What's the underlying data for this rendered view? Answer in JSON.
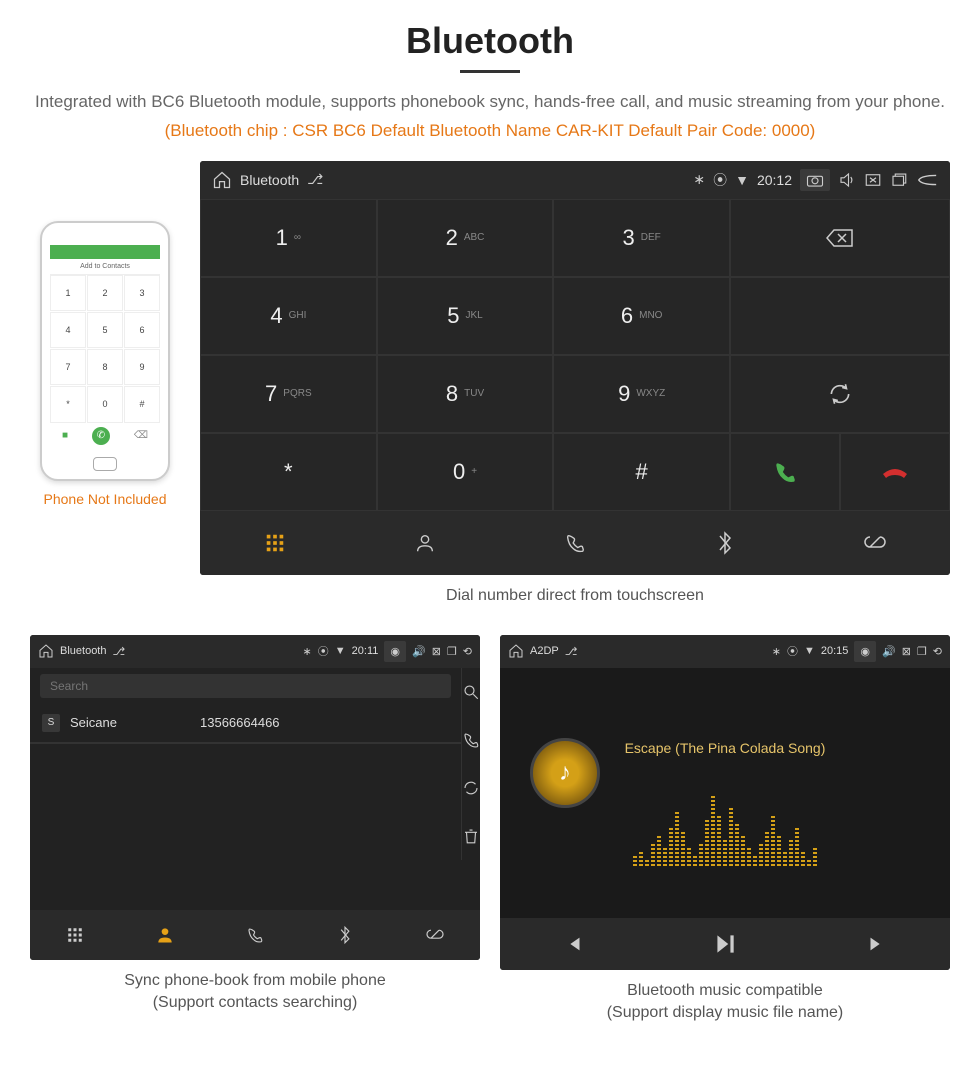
{
  "title": "Bluetooth",
  "description": "Integrated with BC6 Bluetooth module, supports phonebook sync, hands-free call, and music streaming from your phone.",
  "specs": "(Bluetooth chip : CSR BC6    Default Bluetooth Name CAR-KIT    Default Pair Code: 0000)",
  "phone": {
    "add_contacts": "Add to Contacts",
    "keys": [
      "1",
      "2",
      "3",
      "4",
      "5",
      "6",
      "7",
      "8",
      "9",
      "*",
      "0",
      "#"
    ],
    "note": "Phone Not Included"
  },
  "dialer": {
    "status": {
      "title": "Bluetooth",
      "time": "20:12"
    },
    "keys": [
      {
        "num": "1",
        "sub": "∞"
      },
      {
        "num": "2",
        "sub": "ABC"
      },
      {
        "num": "3",
        "sub": "DEF"
      },
      {
        "num": "4",
        "sub": "GHI"
      },
      {
        "num": "5",
        "sub": "JKL"
      },
      {
        "num": "6",
        "sub": "MNO"
      },
      {
        "num": "7",
        "sub": "PQRS"
      },
      {
        "num": "8",
        "sub": "TUV"
      },
      {
        "num": "9",
        "sub": "WXYZ"
      },
      {
        "num": "*",
        "sub": ""
      },
      {
        "num": "0",
        "sub": "+"
      },
      {
        "num": "#",
        "sub": ""
      }
    ],
    "caption": "Dial number direct from touchscreen"
  },
  "phonebook": {
    "status": {
      "title": "Bluetooth",
      "time": "20:11"
    },
    "search_placeholder": "Search",
    "contact": {
      "initial": "S",
      "name": "Seicane",
      "number": "13566664466"
    },
    "caption1": "Sync phone-book from mobile phone",
    "caption2": "(Support contacts searching)"
  },
  "music": {
    "status": {
      "title": "A2DP",
      "time": "20:15"
    },
    "song": "Escape (The Pina Colada Song)",
    "caption1": "Bluetooth music compatible",
    "caption2": "(Support display music file name)"
  }
}
